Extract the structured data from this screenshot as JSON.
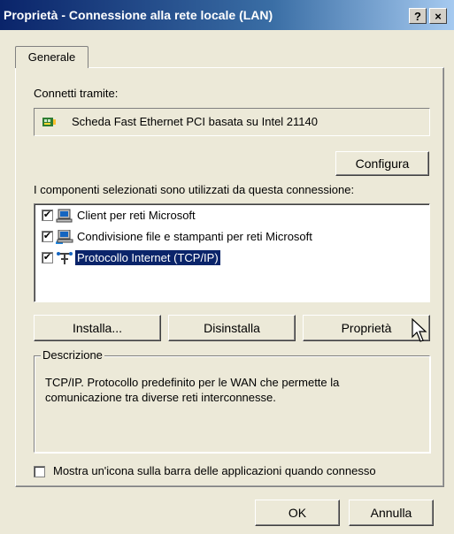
{
  "window": {
    "title": "Proprietà - Connessione alla rete locale (LAN)",
    "help_button": "?",
    "close_button": "×"
  },
  "tabs": [
    {
      "label": "Generale",
      "active": true
    }
  ],
  "connect_via": {
    "label": "Connetti tramite:",
    "adapter": "Scheda Fast Ethernet PCI basata su Intel 21140",
    "configure_button": "Configura"
  },
  "components": {
    "label": "I componenti selezionati sono utilizzati da questa connessione:",
    "items": [
      {
        "label": "Client per reti Microsoft",
        "checked": true,
        "icon": "network-client-icon"
      },
      {
        "label": "Condivisione file e stampanti per reti Microsoft",
        "checked": true,
        "icon": "file-printer-sharing-icon"
      },
      {
        "label": "Protocollo Internet (TCP/IP)",
        "checked": true,
        "icon": "protocol-icon",
        "selected": true
      }
    ]
  },
  "component_buttons": {
    "install": "Installa...",
    "uninstall": "Disinstalla",
    "properties": "Proprietà"
  },
  "description": {
    "legend": "Descrizione",
    "text": "TCP/IP. Protocollo predefinito per le WAN che permette la comunicazione tra diverse reti interconnesse."
  },
  "show_icon": {
    "label": "Mostra un'icona sulla barra delle applicazioni quando connesso",
    "checked": false
  },
  "dialog_buttons": {
    "ok": "OK",
    "cancel": "Annulla"
  },
  "colors": {
    "title_start": "#0a246a",
    "title_end": "#a6caf0",
    "selection": "#0a246a",
    "face": "#ece9d8"
  }
}
